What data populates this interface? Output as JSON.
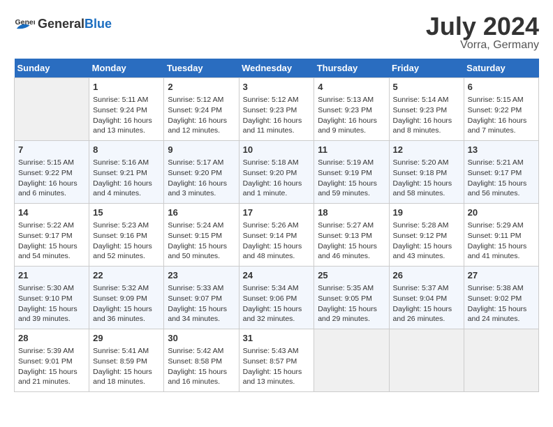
{
  "header": {
    "logo_general": "General",
    "logo_blue": "Blue",
    "month_year": "July 2024",
    "location": "Vorra, Germany"
  },
  "days_of_week": [
    "Sunday",
    "Monday",
    "Tuesday",
    "Wednesday",
    "Thursday",
    "Friday",
    "Saturday"
  ],
  "weeks": [
    [
      {
        "day": "",
        "empty": true
      },
      {
        "day": "1",
        "sunrise": "Sunrise: 5:11 AM",
        "sunset": "Sunset: 9:24 PM",
        "daylight": "Daylight: 16 hours and 13 minutes."
      },
      {
        "day": "2",
        "sunrise": "Sunrise: 5:12 AM",
        "sunset": "Sunset: 9:24 PM",
        "daylight": "Daylight: 16 hours and 12 minutes."
      },
      {
        "day": "3",
        "sunrise": "Sunrise: 5:12 AM",
        "sunset": "Sunset: 9:23 PM",
        "daylight": "Daylight: 16 hours and 11 minutes."
      },
      {
        "day": "4",
        "sunrise": "Sunrise: 5:13 AM",
        "sunset": "Sunset: 9:23 PM",
        "daylight": "Daylight: 16 hours and 9 minutes."
      },
      {
        "day": "5",
        "sunrise": "Sunrise: 5:14 AM",
        "sunset": "Sunset: 9:23 PM",
        "daylight": "Daylight: 16 hours and 8 minutes."
      },
      {
        "day": "6",
        "sunrise": "Sunrise: 5:15 AM",
        "sunset": "Sunset: 9:22 PM",
        "daylight": "Daylight: 16 hours and 7 minutes."
      }
    ],
    [
      {
        "day": "7",
        "sunrise": "Sunrise: 5:15 AM",
        "sunset": "Sunset: 9:22 PM",
        "daylight": "Daylight: 16 hours and 6 minutes."
      },
      {
        "day": "8",
        "sunrise": "Sunrise: 5:16 AM",
        "sunset": "Sunset: 9:21 PM",
        "daylight": "Daylight: 16 hours and 4 minutes."
      },
      {
        "day": "9",
        "sunrise": "Sunrise: 5:17 AM",
        "sunset": "Sunset: 9:20 PM",
        "daylight": "Daylight: 16 hours and 3 minutes."
      },
      {
        "day": "10",
        "sunrise": "Sunrise: 5:18 AM",
        "sunset": "Sunset: 9:20 PM",
        "daylight": "Daylight: 16 hours and 1 minute."
      },
      {
        "day": "11",
        "sunrise": "Sunrise: 5:19 AM",
        "sunset": "Sunset: 9:19 PM",
        "daylight": "Daylight: 15 hours and 59 minutes."
      },
      {
        "day": "12",
        "sunrise": "Sunrise: 5:20 AM",
        "sunset": "Sunset: 9:18 PM",
        "daylight": "Daylight: 15 hours and 58 minutes."
      },
      {
        "day": "13",
        "sunrise": "Sunrise: 5:21 AM",
        "sunset": "Sunset: 9:17 PM",
        "daylight": "Daylight: 15 hours and 56 minutes."
      }
    ],
    [
      {
        "day": "14",
        "sunrise": "Sunrise: 5:22 AM",
        "sunset": "Sunset: 9:17 PM",
        "daylight": "Daylight: 15 hours and 54 minutes."
      },
      {
        "day": "15",
        "sunrise": "Sunrise: 5:23 AM",
        "sunset": "Sunset: 9:16 PM",
        "daylight": "Daylight: 15 hours and 52 minutes."
      },
      {
        "day": "16",
        "sunrise": "Sunrise: 5:24 AM",
        "sunset": "Sunset: 9:15 PM",
        "daylight": "Daylight: 15 hours and 50 minutes."
      },
      {
        "day": "17",
        "sunrise": "Sunrise: 5:26 AM",
        "sunset": "Sunset: 9:14 PM",
        "daylight": "Daylight: 15 hours and 48 minutes."
      },
      {
        "day": "18",
        "sunrise": "Sunrise: 5:27 AM",
        "sunset": "Sunset: 9:13 PM",
        "daylight": "Daylight: 15 hours and 46 minutes."
      },
      {
        "day": "19",
        "sunrise": "Sunrise: 5:28 AM",
        "sunset": "Sunset: 9:12 PM",
        "daylight": "Daylight: 15 hours and 43 minutes."
      },
      {
        "day": "20",
        "sunrise": "Sunrise: 5:29 AM",
        "sunset": "Sunset: 9:11 PM",
        "daylight": "Daylight: 15 hours and 41 minutes."
      }
    ],
    [
      {
        "day": "21",
        "sunrise": "Sunrise: 5:30 AM",
        "sunset": "Sunset: 9:10 PM",
        "daylight": "Daylight: 15 hours and 39 minutes."
      },
      {
        "day": "22",
        "sunrise": "Sunrise: 5:32 AM",
        "sunset": "Sunset: 9:09 PM",
        "daylight": "Daylight: 15 hours and 36 minutes."
      },
      {
        "day": "23",
        "sunrise": "Sunrise: 5:33 AM",
        "sunset": "Sunset: 9:07 PM",
        "daylight": "Daylight: 15 hours and 34 minutes."
      },
      {
        "day": "24",
        "sunrise": "Sunrise: 5:34 AM",
        "sunset": "Sunset: 9:06 PM",
        "daylight": "Daylight: 15 hours and 32 minutes."
      },
      {
        "day": "25",
        "sunrise": "Sunrise: 5:35 AM",
        "sunset": "Sunset: 9:05 PM",
        "daylight": "Daylight: 15 hours and 29 minutes."
      },
      {
        "day": "26",
        "sunrise": "Sunrise: 5:37 AM",
        "sunset": "Sunset: 9:04 PM",
        "daylight": "Daylight: 15 hours and 26 minutes."
      },
      {
        "day": "27",
        "sunrise": "Sunrise: 5:38 AM",
        "sunset": "Sunset: 9:02 PM",
        "daylight": "Daylight: 15 hours and 24 minutes."
      }
    ],
    [
      {
        "day": "28",
        "sunrise": "Sunrise: 5:39 AM",
        "sunset": "Sunset: 9:01 PM",
        "daylight": "Daylight: 15 hours and 21 minutes."
      },
      {
        "day": "29",
        "sunrise": "Sunrise: 5:41 AM",
        "sunset": "Sunset: 8:59 PM",
        "daylight": "Daylight: 15 hours and 18 minutes."
      },
      {
        "day": "30",
        "sunrise": "Sunrise: 5:42 AM",
        "sunset": "Sunset: 8:58 PM",
        "daylight": "Daylight: 15 hours and 16 minutes."
      },
      {
        "day": "31",
        "sunrise": "Sunrise: 5:43 AM",
        "sunset": "Sunset: 8:57 PM",
        "daylight": "Daylight: 15 hours and 13 minutes."
      },
      {
        "day": "",
        "empty": true
      },
      {
        "day": "",
        "empty": true
      },
      {
        "day": "",
        "empty": true
      }
    ]
  ]
}
